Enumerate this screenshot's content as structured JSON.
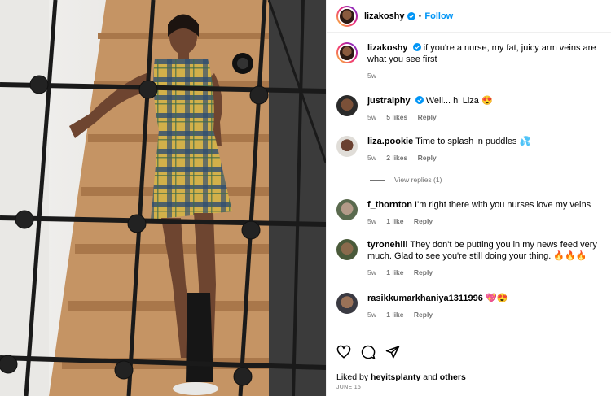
{
  "post": {
    "username": "lizakoshy",
    "follow_label": "Follow",
    "separator": "•"
  },
  "caption": {
    "username": "lizakoshy",
    "text": "if you're a nurse, my fat, juicy arm veins are what you see first",
    "time": "5w"
  },
  "comments": [
    {
      "username": "justralphy",
      "verified": true,
      "text": "Well... hi Liza 😍",
      "time": "5w",
      "likes": "5 likes",
      "reply": "Reply"
    },
    {
      "username": "liza.pookie",
      "verified": false,
      "text": "Time to splash in puddles 💦",
      "time": "5w",
      "likes": "2 likes",
      "reply": "Reply"
    },
    {
      "username": "f_thornton",
      "verified": false,
      "text": "I'm right there with you nurses love my veins",
      "time": "5w",
      "likes": "1 like",
      "reply": "Reply"
    },
    {
      "username": "tyronehill",
      "verified": false,
      "text": "They don't be putting you in my news feed very much. Glad to see you're still doing your thing. 🔥🔥🔥",
      "time": "5w",
      "likes": "1 like",
      "reply": "Reply"
    },
    {
      "username": "rasikkumarkhaniya1311996",
      "verified": false,
      "text": "💖😍",
      "time": "5w",
      "likes": "1 like",
      "reply": "Reply"
    }
  ],
  "view_replies": "View replies (1)",
  "footer": {
    "liked_prefix": "Liked by",
    "liked_user": "heyitsplanty",
    "liked_and": "and",
    "liked_others": "others",
    "date": "JUNE 15"
  },
  "icons": {
    "like": "heart-icon",
    "comment": "comment-bubble-icon",
    "share": "paper-plane-icon",
    "verified": "verified-badge-icon"
  },
  "colors": {
    "accent": "#0095f6",
    "muted": "#737373",
    "verified": "#0095f6"
  }
}
